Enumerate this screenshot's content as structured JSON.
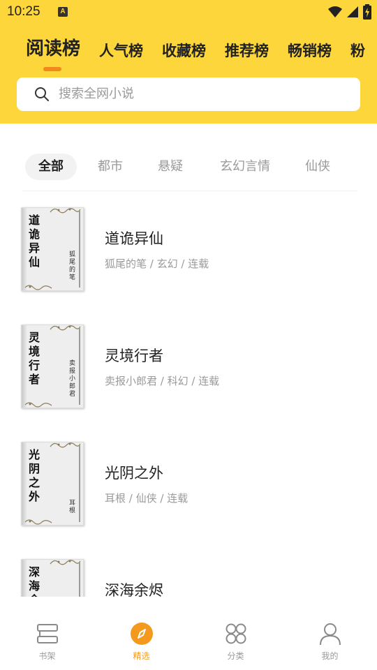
{
  "status_bar": {
    "time": "10:25",
    "notification_icon": "A"
  },
  "header": {
    "tabs": [
      {
        "label": "阅读榜",
        "active": true
      },
      {
        "label": "人气榜"
      },
      {
        "label": "收藏榜"
      },
      {
        "label": "推荐榜"
      },
      {
        "label": "畅销榜"
      },
      {
        "label": "粉"
      }
    ],
    "search_placeholder": "搜索全网小说",
    "accent_color": "#fdd63b",
    "indicator_color": "#f08a1a"
  },
  "categories": [
    {
      "label": "全部",
      "active": true
    },
    {
      "label": "都市"
    },
    {
      "label": "悬疑"
    },
    {
      "label": "玄幻言情"
    },
    {
      "label": "仙侠"
    }
  ],
  "books": [
    {
      "title": "道诡异仙",
      "meta": "狐尾的笔 / 玄幻 / 连载",
      "cover_title": "道诡异仙",
      "cover_author": "狐尾的笔"
    },
    {
      "title": "灵境行者",
      "meta": "卖报小郎君 / 科幻 / 连载",
      "cover_title": "灵境行者",
      "cover_author": "卖报小郎君"
    },
    {
      "title": "光阴之外",
      "meta": "耳根 / 仙侠 / 连载",
      "cover_title": "光阴之外",
      "cover_author": "耳根"
    },
    {
      "title": "深海余烬",
      "meta": "",
      "cover_title": "深海余烬",
      "cover_author": ""
    }
  ],
  "bottom_nav": [
    {
      "label": "书架",
      "icon": "bookshelf-icon"
    },
    {
      "label": "精选",
      "icon": "compass-icon",
      "active": true
    },
    {
      "label": "分类",
      "icon": "category-icon"
    },
    {
      "label": "我的",
      "icon": "profile-icon"
    }
  ]
}
